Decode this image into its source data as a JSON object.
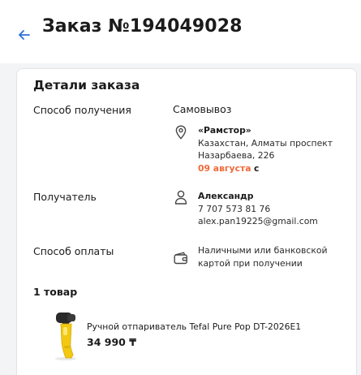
{
  "header": {
    "title": "Заказ №194049028",
    "back_icon": "arrow-left-icon",
    "back_color": "#2c6fd6"
  },
  "order_details": {
    "title": "Детали заказа",
    "delivery": {
      "label": "Способ получения",
      "method": "Самовывоз",
      "icon": "location-pin-icon",
      "store_name": "«Рамстор»",
      "address": "Казахстан, Алматы проспект Назарбаева, 226",
      "date": "09 августа",
      "date_suffix": "с",
      "date_color": "#f06a39"
    },
    "recipient": {
      "label": "Получатель",
      "icon": "person-icon",
      "name": "Александр",
      "phone": "7 707 573 81 76",
      "email": "alex.pan19225@gmail.com"
    },
    "payment": {
      "label": "Способ оплаты",
      "icon": "wallet-icon",
      "method": "Наличными или банковской картой при получении"
    },
    "items": {
      "count_label": "1 товар",
      "list": [
        {
          "name": "Ручной отпариватель Tefal Pure Pop DT-2026E1",
          "price": "34 990 ₸",
          "thumb_color": "#f2c811"
        }
      ]
    }
  }
}
